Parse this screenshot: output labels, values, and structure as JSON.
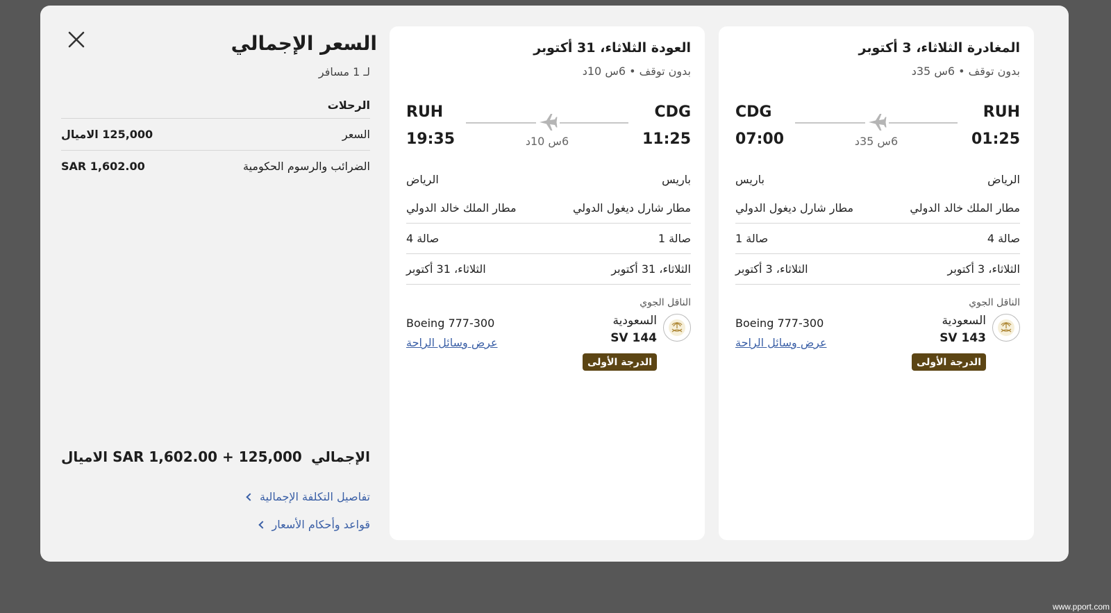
{
  "summary": {
    "title": "السعر الإجمالي",
    "passengers": "لـ 1 مسافر",
    "flights_label": "الرحلات",
    "price_label": "السعر",
    "price_value": "125,000 الاميال",
    "taxes_label": "الضرائب والرسوم الحكومية",
    "taxes_value": "SAR 1,602.00",
    "total_label": "الإجمالي",
    "total_value": "SAR 1,602.00 + 125,000 الاميال",
    "link_cost_details": "تفاصيل التكلفة الإجمالية",
    "link_fare_rules": "قواعد وأحكام الأسعار"
  },
  "return_flight": {
    "header": "العودة الثلاثاء، 31 أكتوبر",
    "subheader": "بدون توقف • 6س 10د",
    "origin_code": "CDG",
    "dest_code": "RUH",
    "dep_time": "11:25",
    "arr_time": "19:35",
    "duration": "6س 10د",
    "origin_city": "باريس",
    "dest_city": "الرياض",
    "origin_airport": "مطار شارل ديغول الدولي",
    "dest_airport": "مطار الملك خالد الدولي",
    "origin_terminal": "صالة 1",
    "dest_terminal": "صالة 4",
    "dep_date": "الثلاثاء، 31 أكتوبر",
    "arr_date": "الثلاثاء، 31 أكتوبر",
    "carrier_label": "الناقل الجوي",
    "airline": "السعودية",
    "flight_number": "SV 144",
    "aircraft": "Boeing 777-300",
    "amenities_link": "عرض وسائل الراحة",
    "cabin": "الدرجة الأولى"
  },
  "outbound_flight": {
    "header": "المغادرة الثلاثاء، 3 أكتوبر",
    "subheader": "بدون توقف • 6س 35د",
    "origin_code": "RUH",
    "dest_code": "CDG",
    "dep_time": "01:25",
    "arr_time": "07:00",
    "duration": "6س 35د",
    "origin_city": "الرياض",
    "dest_city": "باريس",
    "origin_airport": "مطار الملك خالد الدولي",
    "dest_airport": "مطار شارل ديغول الدولي",
    "origin_terminal": "صالة 4",
    "dest_terminal": "صالة 1",
    "dep_date": "الثلاثاء، 3 أكتوبر",
    "arr_date": "الثلاثاء، 3 أكتوبر",
    "carrier_label": "الناقل الجوي",
    "airline": "السعودية",
    "flight_number": "SV 143",
    "aircraft": "Boeing 777-300",
    "amenities_link": "عرض وسائل الراحة",
    "cabin": "الدرجة الأولى"
  },
  "icons": {
    "close": "close-icon",
    "plane": "airplane-icon",
    "logo": "saudia-logo-icon"
  },
  "colors": {
    "overlay": "#575757",
    "link": "#3a5fa6",
    "cabin_badge": "#5c4514"
  },
  "watermark": "www.pport.com"
}
